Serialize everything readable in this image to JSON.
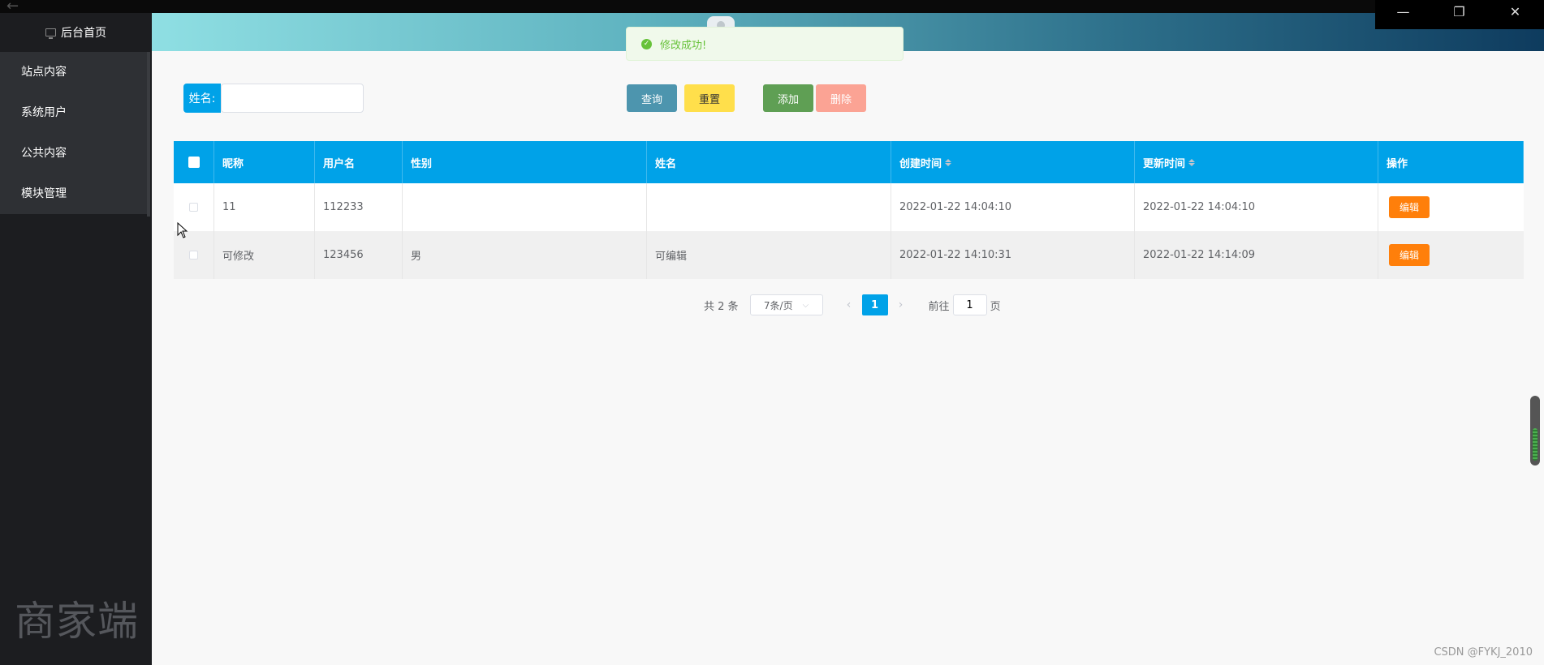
{
  "sidebar": {
    "home_label": "后台首页",
    "items": [
      {
        "label": "站点内容"
      },
      {
        "label": "系统用户"
      },
      {
        "label": "公共内容"
      },
      {
        "label": "模块管理"
      }
    ],
    "watermark": "商家端"
  },
  "toast": {
    "message": "修改成功!",
    "color": "#67c23a"
  },
  "search": {
    "label": "姓名:",
    "value": "",
    "placeholder": ""
  },
  "toolbar": {
    "query_label": "查询",
    "reset_label": "重置",
    "add_label": "添加",
    "delete_label": "删除"
  },
  "table": {
    "header_color": "#00a2e8",
    "columns": [
      "昵称",
      "用户名",
      "性别",
      "姓名",
      "创建时间",
      "更新时间",
      "操作"
    ],
    "rows": [
      {
        "nickname": "11",
        "username": "112233",
        "gender": "",
        "name": "",
        "created": "2022-01-22 14:04:10",
        "updated": "2022-01-22 14:04:10",
        "action": "编辑"
      },
      {
        "nickname": "可修改",
        "username": "123456",
        "gender": "男",
        "name": "可编辑",
        "created": "2022-01-22 14:10:31",
        "updated": "2022-01-22 14:14:09",
        "action": "编辑"
      }
    ]
  },
  "pagination": {
    "total": "共 2 条",
    "page_size": "7条/页",
    "current_page": "1",
    "goto_prefix": "前往",
    "goto_value": "1",
    "goto_suffix": "页"
  },
  "footer": {
    "credit": "CSDN @FYKJ_2010"
  },
  "colors": {
    "edit_button": "#ff7f0a",
    "accent": "#00a2e8"
  }
}
